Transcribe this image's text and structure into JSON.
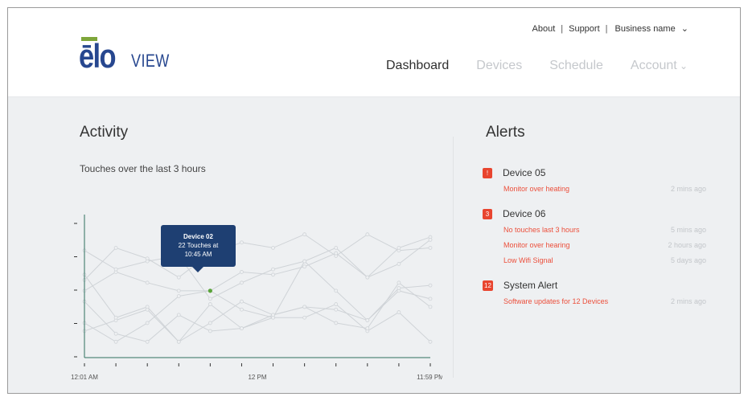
{
  "header": {
    "logo": {
      "brand": "ēlo",
      "product": "VIEW"
    },
    "links": {
      "about": "About",
      "support": "Support",
      "business": "Business name"
    },
    "nav": [
      "Dashboard",
      "Devices",
      "Schedule",
      "Account"
    ],
    "active_nav": "Dashboard"
  },
  "activity": {
    "title": "Activity",
    "subtitle": "Touches over the last 3 hours",
    "tooltip": {
      "title": "Device 02",
      "line1": "22 Touches at",
      "line2": "10:45 AM"
    }
  },
  "alerts": {
    "title": "Alerts",
    "groups": [
      {
        "badge": "!",
        "device": "Device 05",
        "items": [
          {
            "message": "Monitor over heating",
            "time": "2 mins ago"
          }
        ]
      },
      {
        "badge": "3",
        "device": "Device 06",
        "items": [
          {
            "message": "No touches last 3 hours",
            "time": "5 mins ago"
          },
          {
            "message": "Monitor over hearing",
            "time": "2 hours ago"
          },
          {
            "message": "Low Wifi Signal",
            "time": "5 days ago"
          }
        ]
      },
      {
        "badge": "12",
        "device": "System Alert",
        "items": [
          {
            "message": "Software updates for 12 Devices",
            "time": "2 mins ago"
          }
        ]
      }
    ]
  },
  "colors": {
    "brand_blue": "#27478f",
    "brand_green": "#7ea63a",
    "alert_red": "#ec4f3b",
    "axis": "#2f6f5f"
  },
  "chart_data": {
    "type": "line",
    "xlabel": "",
    "ylabel": "",
    "x_tick_labels": [
      "12:01 AM",
      "12 PM",
      "11:59 PM"
    ],
    "x": [
      0,
      1,
      2,
      3,
      4,
      5,
      6,
      7,
      8,
      9,
      10,
      11
    ],
    "ylim": [
      0,
      5
    ],
    "highlight": {
      "series": 1,
      "x": 4,
      "y": 2.4
    },
    "series": [
      {
        "values": [
          2.8,
          4.0,
          3.6,
          2.9,
          3.8,
          4.2,
          4.0,
          4.5,
          3.7,
          4.5,
          3.9,
          4.0
        ]
      },
      {
        "values": [
          2.4,
          3.1,
          2.7,
          2.4,
          2.4,
          3.1,
          3.0,
          3.3,
          3.8,
          2.9,
          4.0,
          4.4
        ]
      },
      {
        "values": [
          3.9,
          3.2,
          3.5,
          3.7,
          2.1,
          2.7,
          3.2,
          3.5,
          4.0,
          2.9,
          3.4,
          4.3
        ]
      },
      {
        "values": [
          1.2,
          0.5,
          1.2,
          2.2,
          2.4,
          1.7,
          1.4,
          3.5,
          2.4,
          1.3,
          2.4,
          2.1
        ]
      },
      {
        "values": [
          0.9,
          1.3,
          1.7,
          0.5,
          1.2,
          2.0,
          1.5,
          1.8,
          1.7,
          1.3,
          2.5,
          2.6
        ]
      },
      {
        "values": [
          2.0,
          0.8,
          0.5,
          1.5,
          0.9,
          1.0,
          1.4,
          1.4,
          1.9,
          0.9,
          1.6,
          0.5
        ]
      },
      {
        "values": [
          3.0,
          1.4,
          1.8,
          0.5,
          1.9,
          1.0,
          1.5,
          1.8,
          1.2,
          1.0,
          2.7,
          1.8
        ]
      }
    ]
  }
}
